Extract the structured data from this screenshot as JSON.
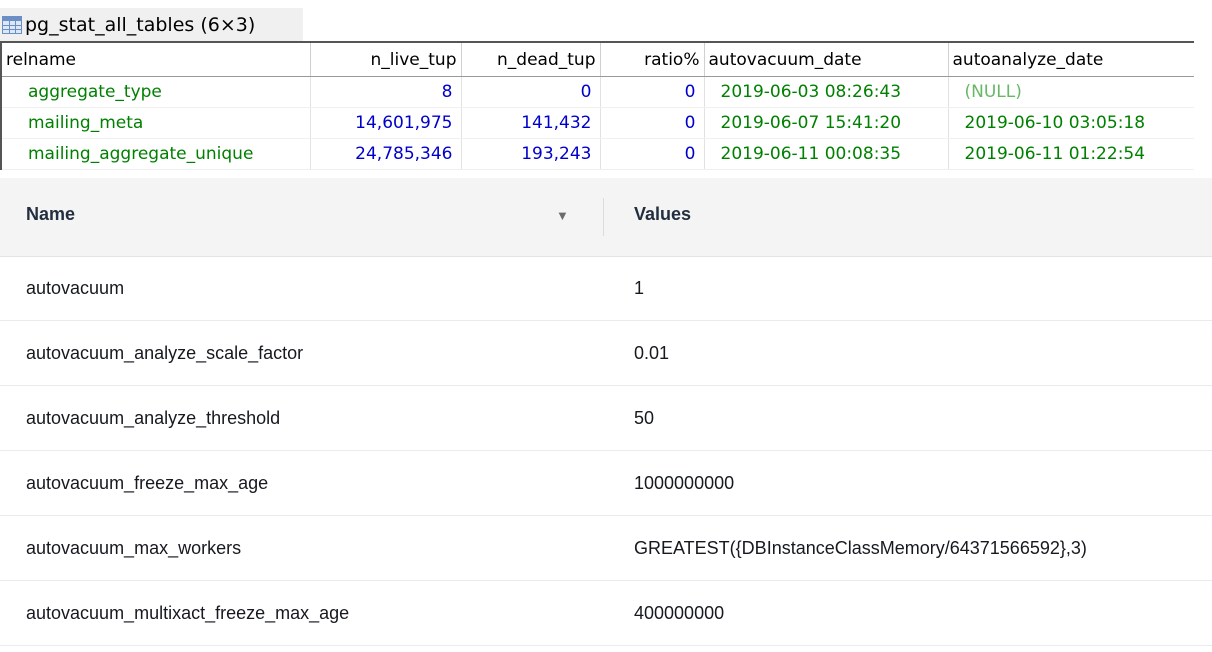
{
  "result": {
    "title": "pg_stat_all_tables (6×3)",
    "columns": [
      "relname",
      "n_live_tup",
      "n_dead_tup",
      "ratio%",
      "autovacuum_date",
      "autoanalyze_date"
    ],
    "rows": [
      {
        "relname": "aggregate_type",
        "n_live_tup": "8",
        "n_dead_tup": "0",
        "ratio": "0",
        "autovacuum_date": "2019-06-03 08:26:43",
        "autoanalyze_date": "(NULL)"
      },
      {
        "relname": "mailing_meta",
        "n_live_tup": "14,601,975",
        "n_dead_tup": "141,432",
        "ratio": "0",
        "autovacuum_date": "2019-06-07 15:41:20",
        "autoanalyze_date": "2019-06-10 03:05:18"
      },
      {
        "relname": "mailing_aggregate_unique",
        "n_live_tup": "24,785,346",
        "n_dead_tup": "193,243",
        "ratio": "0",
        "autovacuum_date": "2019-06-11 00:08:35",
        "autoanalyze_date": "2019-06-11 01:22:54"
      }
    ],
    "colors": {
      "number": "#0000cc",
      "text": "#008000",
      "null": "#66b866"
    }
  },
  "params": {
    "header": {
      "name": "Name",
      "values": "Values",
      "sort_icon": "sort-descending-icon"
    },
    "rows": [
      {
        "name": "autovacuum",
        "value": "1"
      },
      {
        "name": "autovacuum_analyze_scale_factor",
        "value": "0.01"
      },
      {
        "name": "autovacuum_analyze_threshold",
        "value": "50"
      },
      {
        "name": "autovacuum_freeze_max_age",
        "value": "1000000000"
      },
      {
        "name": "autovacuum_max_workers",
        "value": "GREATEST({DBInstanceClassMemory/64371566592},3)"
      },
      {
        "name": "autovacuum_multixact_freeze_max_age",
        "value": "400000000"
      }
    ]
  }
}
